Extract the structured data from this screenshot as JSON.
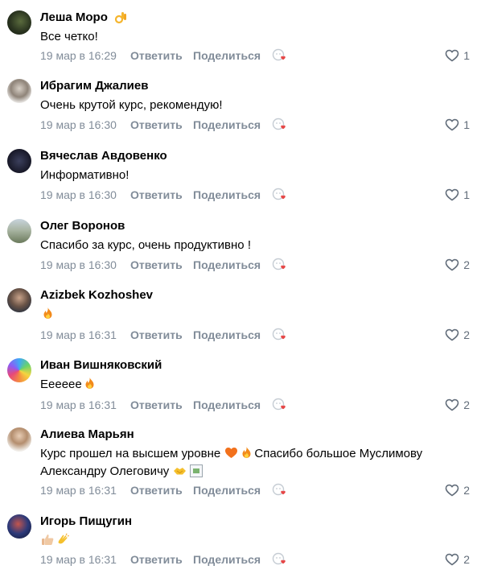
{
  "actions": {
    "reply": "Ответить",
    "share": "Поделиться"
  },
  "comments": [
    {
      "author": "Леша Моро",
      "text": "Все четко!",
      "date": "19 мар в 16:29",
      "likes": "1"
    },
    {
      "author": "Ибрагим Джалиев",
      "text": "Очень крутой курс, рекомендую!",
      "date": "19 мар в 16:30",
      "likes": "1"
    },
    {
      "author": "Вячеслав Авдовенко",
      "text": "Информативно!",
      "date": "19 мар в 16:30",
      "likes": "1"
    },
    {
      "author": "Олег Воронов",
      "text": "Спасибо за курс, очень продуктивно !",
      "date": "19 мар в 16:30",
      "likes": "2"
    },
    {
      "author": "Azizbek Kozhoshev",
      "text": "",
      "date": "19 мар в 16:31",
      "likes": "2"
    },
    {
      "author": "Иван Вишняковский",
      "text": "Ееееее",
      "date": "19 мар в 16:31",
      "likes": "2"
    },
    {
      "author": "Алиева Марьян",
      "text_line1_a": "Курс прошел на высшем уровне ",
      "text_line1_b": "Спасибо большое Муслимову",
      "text_line2": "Александру Олеговичу ",
      "date": "19 мар в 16:31",
      "likes": "2"
    },
    {
      "author": "Игорь Пищугин",
      "text": "",
      "date": "19 мар в 16:31",
      "likes": "2"
    }
  ],
  "colors": {
    "meta": "#818c99",
    "like": "#626d7a",
    "heart_badge": "#e64646"
  }
}
